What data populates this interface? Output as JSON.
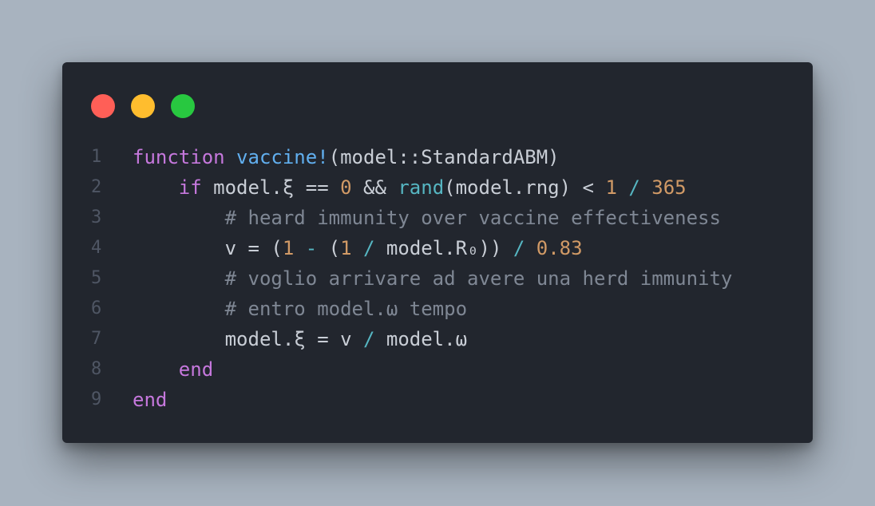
{
  "window": {
    "traffic_lights": [
      {
        "name": "close",
        "color": "#ff5f57"
      },
      {
        "name": "minimize",
        "color": "#ffbd2e"
      },
      {
        "name": "zoom",
        "color": "#28c840"
      }
    ]
  },
  "code": {
    "lines": [
      {
        "number": "1",
        "tokens": [
          {
            "text": "function",
            "type": "kw"
          },
          {
            "text": " ",
            "type": "tx"
          },
          {
            "text": "vaccine!",
            "type": "fn"
          },
          {
            "text": "(model::StandardABM)",
            "type": "tx"
          }
        ]
      },
      {
        "number": "2",
        "tokens": [
          {
            "text": "    ",
            "type": "tx"
          },
          {
            "text": "if",
            "type": "kw"
          },
          {
            "text": " model.ξ == ",
            "type": "tx"
          },
          {
            "text": "0",
            "type": "num"
          },
          {
            "text": " && ",
            "type": "tx"
          },
          {
            "text": "rand",
            "type": "call"
          },
          {
            "text": "(model.rng) < ",
            "type": "tx"
          },
          {
            "text": "1",
            "type": "num"
          },
          {
            "text": " ",
            "type": "tx"
          },
          {
            "text": "/",
            "type": "op"
          },
          {
            "text": " ",
            "type": "tx"
          },
          {
            "text": "365",
            "type": "num"
          }
        ]
      },
      {
        "number": "3",
        "tokens": [
          {
            "text": "        ",
            "type": "tx"
          },
          {
            "text": "# heard immunity over vaccine effectiveness",
            "type": "cm"
          }
        ]
      },
      {
        "number": "4",
        "tokens": [
          {
            "text": "        v = (",
            "type": "tx"
          },
          {
            "text": "1",
            "type": "num"
          },
          {
            "text": " ",
            "type": "tx"
          },
          {
            "text": "-",
            "type": "op"
          },
          {
            "text": " (",
            "type": "tx"
          },
          {
            "text": "1",
            "type": "num"
          },
          {
            "text": " ",
            "type": "tx"
          },
          {
            "text": "/",
            "type": "op"
          },
          {
            "text": " model.R₀)) ",
            "type": "tx"
          },
          {
            "text": "/",
            "type": "op"
          },
          {
            "text": " ",
            "type": "tx"
          },
          {
            "text": "0.83",
            "type": "num"
          }
        ]
      },
      {
        "number": "5",
        "tokens": [
          {
            "text": "        ",
            "type": "tx"
          },
          {
            "text": "# voglio arrivare ad avere una herd immunity",
            "type": "cm"
          }
        ]
      },
      {
        "number": "6",
        "tokens": [
          {
            "text": "        ",
            "type": "tx"
          },
          {
            "text": "# entro model.ω tempo",
            "type": "cm"
          }
        ]
      },
      {
        "number": "7",
        "tokens": [
          {
            "text": "        model.ξ = v ",
            "type": "tx"
          },
          {
            "text": "/",
            "type": "op"
          },
          {
            "text": " model.ω",
            "type": "tx"
          }
        ]
      },
      {
        "number": "8",
        "tokens": [
          {
            "text": "    ",
            "type": "tx"
          },
          {
            "text": "end",
            "type": "kw"
          }
        ]
      },
      {
        "number": "9",
        "tokens": [
          {
            "text": "end",
            "type": "kw"
          }
        ]
      }
    ]
  }
}
